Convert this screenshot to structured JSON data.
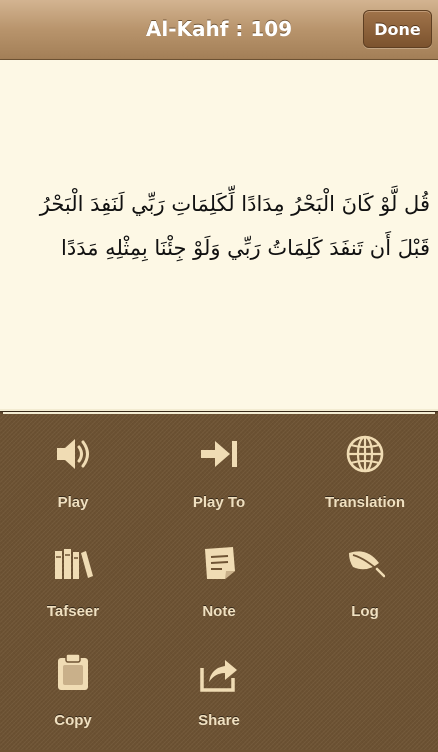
{
  "header": {
    "title": "Al-Kahf : 109",
    "done_label": "Done"
  },
  "verse": {
    "text": "قُل لَّوْ كَانَ الْبَحْرُ مِدَادًا لِّكَلِمَاتِ رَبِّي لَنَفِدَ الْبَحْرُ قَبْلَ أَن تَنفَدَ كَلِمَاتُ رَبِّي وَلَوْ جِئْنَا بِمِثْلِهِ مَدَدًا"
  },
  "actions": [
    {
      "label": "Play",
      "icon": "speaker-icon"
    },
    {
      "label": "Play To",
      "icon": "play-to-icon"
    },
    {
      "label": "Translation",
      "icon": "globe-icon"
    },
    {
      "label": "Tafseer",
      "icon": "books-icon"
    },
    {
      "label": "Note",
      "icon": "note-icon"
    },
    {
      "label": "Log",
      "icon": "leaf-icon"
    },
    {
      "label": "Copy",
      "icon": "clipboard-icon"
    },
    {
      "label": "Share",
      "icon": "share-icon"
    }
  ],
  "colors": {
    "icon": "#f0dcb4",
    "label": "#f0e0c0",
    "paper": "#fdf8e5",
    "bar": "#b8946c"
  }
}
